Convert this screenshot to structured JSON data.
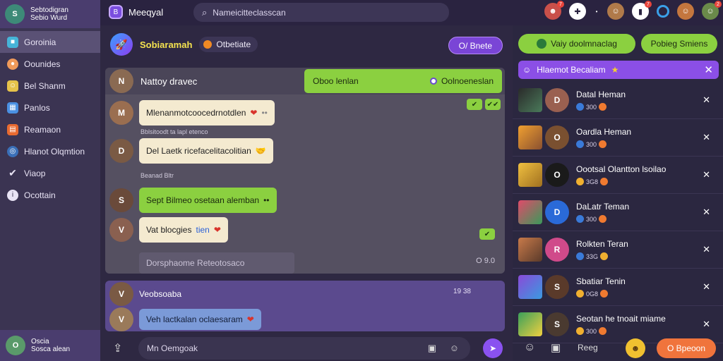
{
  "sidebar": {
    "profile_line1": "Sebtodigran",
    "profile_line2": "Sebio Wurd",
    "items": [
      {
        "label": "Goroinia",
        "icon": "folder-icon",
        "color": "#46b4d8"
      },
      {
        "label": "Oounides",
        "icon": "user-icon",
        "color": "#f09a5a"
      },
      {
        "label": "Bel Shanm",
        "icon": "person-icon",
        "color": "#e6c24a"
      },
      {
        "label": "Panlos",
        "icon": "image-icon",
        "color": "#4a90e2"
      },
      {
        "label": "Reamaon",
        "icon": "chart-icon",
        "color": "#e86a30"
      },
      {
        "label": "Hlanot Olqmtion",
        "icon": "globe-icon",
        "color": "#3a6fb8"
      },
      {
        "label": "Viaop",
        "icon": "gear-icon",
        "color": "#e8e3f4"
      },
      {
        "label": "Ocottain",
        "icon": "info-icon",
        "color": "#e8e3f4"
      }
    ],
    "me_line1": "Oscia",
    "me_line2": "Sosca alean"
  },
  "topbar": {
    "brand": "Meeqyal",
    "search_placeholder": "Nameicitteclasscan",
    "badges": [
      "7",
      "7",
      "2"
    ]
  },
  "chat": {
    "room_name": "Sobiaramah",
    "status": "Otbetiate",
    "header_button": "O/ Bnete",
    "panel_title": "Nattoy dravec",
    "green_pill_left": "Oboo lenlan",
    "green_pill_right": "Oolnoeneslan",
    "messages": [
      {
        "text": "Mlenanmotcoocedrnotdlen",
        "emoji": "❤",
        "extra": "••"
      },
      {
        "text": "Del Laetk ricefacelitacolitian",
        "emoji": "🤝"
      },
      {
        "text": "Sept Bilmeo osetaan alemban",
        "emoji": "••"
      },
      {
        "text": "Vat blocgies",
        "accent": "tien",
        "emoji": "❤"
      }
    ],
    "meta1": "Bblsitoodt ta lapl etenco",
    "meta2": "Beanad Bltr",
    "ghost_text": "Dorsphaome Reteotosaco",
    "panel_foot": "O 9.0",
    "panel2_name": "Veobsoaba",
    "panel2_time": "19 38",
    "panel2_msg": "Veh lactkalan oclaesaram",
    "composer_placeholder": "Mn Oemgoak"
  },
  "right": {
    "btn1": "Vaiy doolmnaclag",
    "btn2": "Pobieg Smiens",
    "tab_label": "Hlaemot Becaliam",
    "items": [
      {
        "name": "Datal Heman",
        "sub": "300"
      },
      {
        "name": "Oardla Heman",
        "sub": "300"
      },
      {
        "name": "Oootsal Olantton lsoilao",
        "sub": "3G8"
      },
      {
        "name": "DaLatr Teman",
        "sub": "300"
      },
      {
        "name": "Rolkten Teran",
        "sub": "33G"
      },
      {
        "name": "Sbatiar Tenin",
        "sub": "0G8"
      },
      {
        "name": "Seotan he tnoait miame",
        "sub": "300"
      }
    ],
    "footer_search": "Reeg",
    "footer_button": "O Bpeoon"
  },
  "colors": {
    "accent_purple": "#8a52f0",
    "accent_green": "#8bd040",
    "accent_orange": "#f0743c"
  }
}
